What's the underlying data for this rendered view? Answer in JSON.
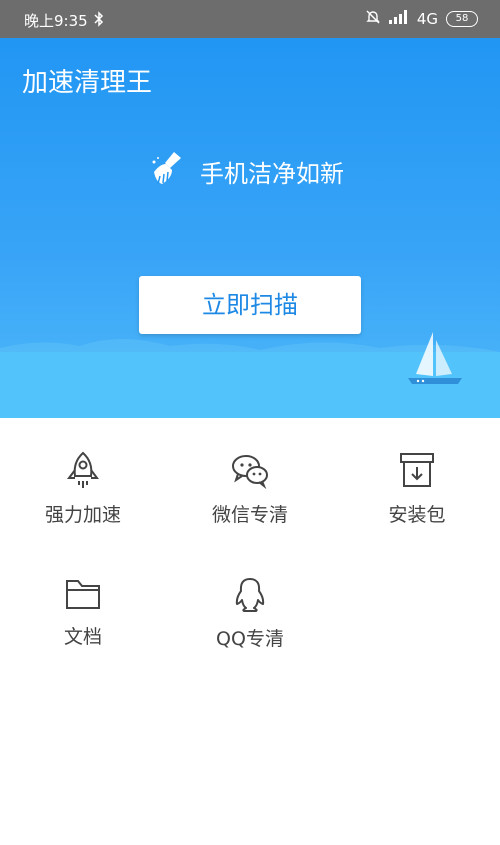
{
  "status_bar": {
    "time": "晚上9:35",
    "network": "4G",
    "battery": "58"
  },
  "header": {
    "title": "加速清理王"
  },
  "hero": {
    "tagline": "手机洁净如新",
    "scan_label": "立即扫描"
  },
  "tools": [
    {
      "label": "强力加速",
      "icon": "rocket-icon"
    },
    {
      "label": "微信专清",
      "icon": "wechat-icon"
    },
    {
      "label": "安装包",
      "icon": "package-icon"
    },
    {
      "label": "文档",
      "icon": "folder-icon"
    },
    {
      "label": "QQ专清",
      "icon": "qq-icon"
    }
  ],
  "colors": {
    "hero_top": "#2196f3",
    "hero_bottom": "#4fbaf9",
    "button_text": "#1e88e5"
  }
}
